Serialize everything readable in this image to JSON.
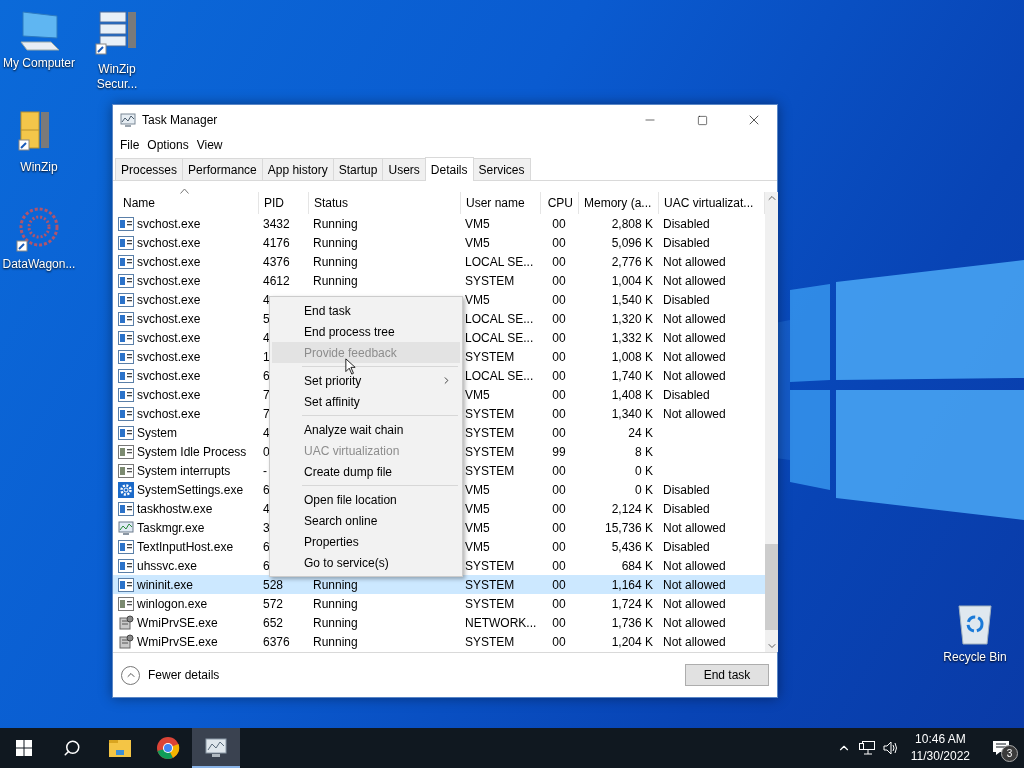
{
  "desktop_icons": [
    {
      "kind": "computer",
      "label": "My Computer"
    },
    {
      "kind": "winzip",
      "label": "WinZip"
    },
    {
      "kind": "datawagon",
      "label": "DataWagon..."
    },
    {
      "kind": "winzip-secure",
      "label": "WinZip Secur..."
    },
    {
      "kind": "recycle",
      "label": "Recycle Bin"
    }
  ],
  "window": {
    "title": "Task Manager",
    "menu": [
      "File",
      "Options",
      "View"
    ],
    "tabs": [
      {
        "label": "Processes",
        "selected": false
      },
      {
        "label": "Performance",
        "selected": false
      },
      {
        "label": "App history",
        "selected": false
      },
      {
        "label": "Startup",
        "selected": false
      },
      {
        "label": "Users",
        "selected": false
      },
      {
        "label": "Details",
        "selected": true
      },
      {
        "label": "Services",
        "selected": false
      }
    ],
    "table": {
      "columns": [
        {
          "label": "Name",
          "sorted": true
        },
        {
          "label": "PID",
          "sorted": false
        },
        {
          "label": "Status",
          "sorted": false
        },
        {
          "label": "User name",
          "sorted": false
        },
        {
          "label": "CPU",
          "sorted": false
        },
        {
          "label": "Memory (a...",
          "sorted": false
        },
        {
          "label": "UAC virtualizat...",
          "sorted": false
        }
      ],
      "rows": [
        {
          "kind": "app",
          "name": "svchost.exe",
          "pid": "3432",
          "status": "Running",
          "user": "VM5",
          "cpu": "00",
          "memory": "2,808 K",
          "uac": "Disabled",
          "selected": false
        },
        {
          "kind": "app",
          "name": "svchost.exe",
          "pid": "4176",
          "status": "Running",
          "user": "VM5",
          "cpu": "00",
          "memory": "5,096 K",
          "uac": "Disabled",
          "selected": false
        },
        {
          "kind": "app",
          "name": "svchost.exe",
          "pid": "4376",
          "status": "Running",
          "user": "LOCAL SE...",
          "cpu": "00",
          "memory": "2,776 K",
          "uac": "Not allowed",
          "selected": false
        },
        {
          "kind": "app",
          "name": "svchost.exe",
          "pid": "4612",
          "status": "Running",
          "user": "SYSTEM",
          "cpu": "00",
          "memory": "1,004 K",
          "uac": "Not allowed",
          "selected": false
        },
        {
          "kind": "app",
          "name": "svchost.exe",
          "pid": "4",
          "user": "VM5",
          "cpu": "00",
          "memory": "1,540 K",
          "uac": "Disabled",
          "selected": false
        },
        {
          "kind": "app",
          "name": "svchost.exe",
          "pid": "5",
          "user": "LOCAL SE...",
          "cpu": "00",
          "memory": "1,320 K",
          "uac": "Not allowed",
          "selected": false
        },
        {
          "kind": "app",
          "name": "svchost.exe",
          "pid": "4",
          "user": "LOCAL SE...",
          "cpu": "00",
          "memory": "1,332 K",
          "uac": "Not allowed",
          "selected": false
        },
        {
          "kind": "app",
          "name": "svchost.exe",
          "pid": "1",
          "user": "SYSTEM",
          "cpu": "00",
          "memory": "1,008 K",
          "uac": "Not allowed",
          "selected": false
        },
        {
          "kind": "app",
          "name": "svchost.exe",
          "pid": "6",
          "user": "LOCAL SE...",
          "cpu": "00",
          "memory": "1,740 K",
          "uac": "Not allowed",
          "selected": false
        },
        {
          "kind": "app",
          "name": "svchost.exe",
          "pid": "7",
          "user": "VM5",
          "cpu": "00",
          "memory": "1,408 K",
          "uac": "Disabled",
          "selected": false
        },
        {
          "kind": "app",
          "name": "svchost.exe",
          "pid": "7",
          "user": "SYSTEM",
          "cpu": "00",
          "memory": "1,340 K",
          "uac": "Not allowed",
          "selected": false
        },
        {
          "kind": "app",
          "name": "System",
          "pid": "4",
          "user": "SYSTEM",
          "cpu": "00",
          "memory": "24 K",
          "selected": false
        },
        {
          "kind": "system",
          "name": "System Idle Process",
          "pid": "0",
          "user": "SYSTEM",
          "cpu": "99",
          "memory": "8 K",
          "selected": false
        },
        {
          "kind": "system",
          "name": "System interrupts",
          "pid": "-",
          "user": "SYSTEM",
          "cpu": "00",
          "memory": "0 K",
          "selected": false
        },
        {
          "kind": "gear",
          "name": "SystemSettings.exe",
          "pid": "6",
          "user": "VM5",
          "cpu": "00",
          "memory": "0 K",
          "uac": "Disabled",
          "selected": false
        },
        {
          "kind": "app",
          "name": "taskhostw.exe",
          "pid": "4",
          "user": "VM5",
          "cpu": "00",
          "memory": "2,124 K",
          "uac": "Disabled",
          "selected": false
        },
        {
          "kind": "chart",
          "name": "Taskmgr.exe",
          "pid": "3",
          "user": "VM5",
          "cpu": "00",
          "memory": "15,736 K",
          "uac": "Not allowed",
          "selected": false
        },
        {
          "kind": "app",
          "name": "TextInputHost.exe",
          "pid": "6",
          "user": "VM5",
          "cpu": "00",
          "memory": "5,436 K",
          "uac": "Disabled",
          "selected": false
        },
        {
          "kind": "app",
          "name": "uhssvc.exe",
          "pid": "6",
          "user": "SYSTEM",
          "cpu": "00",
          "memory": "684 K",
          "uac": "Not allowed",
          "selected": false
        },
        {
          "kind": "app",
          "name": "wininit.exe",
          "pid": "528",
          "status": "Running",
          "user": "SYSTEM",
          "cpu": "00",
          "memory": "1,164 K",
          "uac": "Not allowed",
          "selected": true
        },
        {
          "kind": "system",
          "name": "winlogon.exe",
          "pid": "572",
          "status": "Running",
          "user": "SYSTEM",
          "cpu": "00",
          "memory": "1,724 K",
          "uac": "Not allowed",
          "selected": false
        },
        {
          "kind": "wmi",
          "name": "WmiPrvSE.exe",
          "pid": "652",
          "status": "Running",
          "user": "NETWORK...",
          "cpu": "00",
          "memory": "1,736 K",
          "uac": "Not allowed",
          "selected": false
        },
        {
          "kind": "wmi",
          "name": "WmiPrvSE.exe",
          "pid": "6376",
          "status": "Running",
          "user": "SYSTEM",
          "cpu": "00",
          "memory": "1,204 K",
          "uac": "Not allowed",
          "selected": false
        }
      ]
    },
    "context_menu": [
      {
        "kind": "item",
        "label": "End task",
        "disabled": false,
        "highlighted": false
      },
      {
        "kind": "item",
        "label": "End process tree",
        "disabled": false,
        "highlighted": false
      },
      {
        "kind": "item",
        "label": "Provide feedback",
        "disabled": true,
        "highlighted": true
      },
      {
        "kind": "separator"
      },
      {
        "kind": "submenu",
        "label": "Set priority",
        "disabled": false,
        "highlighted": false
      },
      {
        "kind": "item",
        "label": "Set affinity",
        "disabled": false,
        "highlighted": false
      },
      {
        "kind": "separator"
      },
      {
        "kind": "item",
        "label": "Analyze wait chain",
        "disabled": false,
        "highlighted": false
      },
      {
        "kind": "item",
        "label": "UAC virtualization",
        "disabled": true,
        "highlighted": false
      },
      {
        "kind": "item",
        "label": "Create dump file",
        "disabled": false,
        "highlighted": false
      },
      {
        "kind": "separator"
      },
      {
        "kind": "item",
        "label": "Open file location",
        "disabled": false,
        "highlighted": false
      },
      {
        "kind": "item",
        "label": "Search online",
        "disabled": false,
        "highlighted": false
      },
      {
        "kind": "item",
        "label": "Properties",
        "disabled": false,
        "highlighted": false
      },
      {
        "kind": "item",
        "label": "Go to service(s)",
        "disabled": false,
        "highlighted": false
      }
    ],
    "footer": {
      "toggle": "Fewer details",
      "button": "End task"
    }
  },
  "taskbar": {
    "apps": [
      {
        "kind": "explorer",
        "active": false
      },
      {
        "kind": "chrome",
        "active": false
      },
      {
        "kind": "taskmgr",
        "active": true
      }
    ],
    "time": "10:46 AM",
    "date": "11/30/2022",
    "notifications": "3"
  }
}
